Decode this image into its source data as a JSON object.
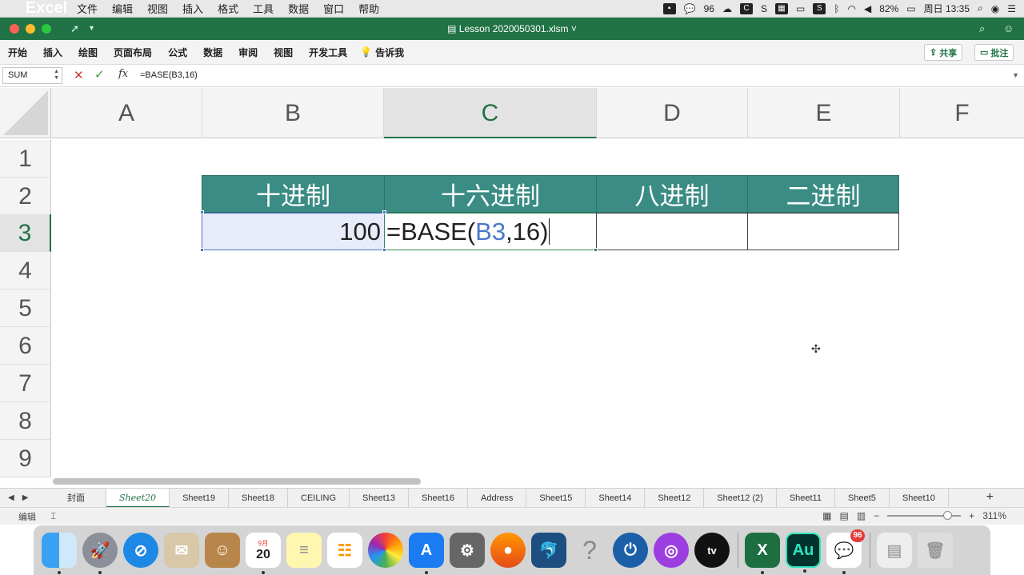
{
  "menubar": {
    "app_name": "Excel",
    "items": [
      "文件",
      "编辑",
      "视图",
      "插入",
      "格式",
      "工具",
      "数据",
      "窗口",
      "帮助"
    ],
    "wechat_count": "96",
    "battery": "82%",
    "clock": "周日 13:35"
  },
  "window": {
    "title": "Lesson 2020050301.xlsm"
  },
  "ribbon": {
    "tabs": [
      "开始",
      "插入",
      "绘图",
      "页面布局",
      "公式",
      "数据",
      "审阅",
      "视图",
      "开发工具"
    ],
    "tell_me": "告诉我",
    "share_label": "共享",
    "comment_label": "批注"
  },
  "formula_bar": {
    "name_box": "SUM",
    "fx_label": "fx",
    "formula": "=BASE(B3,16)"
  },
  "grid": {
    "columns": [
      "A",
      "B",
      "C",
      "D",
      "E",
      "F"
    ],
    "selected_column": "C",
    "rows": [
      "1",
      "2",
      "3",
      "4",
      "5",
      "6",
      "7",
      "8",
      "9"
    ],
    "selected_row": "3",
    "headers": {
      "b2": "十进制",
      "c2": "十六进制",
      "d2": "八进制",
      "e2": "二进制"
    },
    "b3_value": "100",
    "c3_edit": {
      "prefix": "=BASE(",
      "ref": "B3",
      "suffix": ",16)"
    },
    "header_fill": "#3a8c84"
  },
  "sheets": {
    "tabs": [
      "封面",
      "Sheet20",
      "Sheet19",
      "Sheet18",
      "CEILING",
      "Sheet13",
      "Sheet16",
      "Address",
      "Sheet15",
      "Sheet14",
      "Sheet12",
      "Sheet12 (2)",
      "Sheet11",
      "Sheet5",
      "Sheet10"
    ],
    "active": "Sheet20"
  },
  "status": {
    "mode": "编辑",
    "zoom": "311%"
  },
  "dock": {
    "calendar_month": "9月",
    "calendar_day": "20",
    "wechat_badge": "96",
    "excel_letter": "X",
    "audition_letters": "Au",
    "tv_label": "tv",
    "help_glyph": "?"
  },
  "colors": {
    "excel_green": "#217346",
    "selection_blue": "#4a78c8"
  }
}
